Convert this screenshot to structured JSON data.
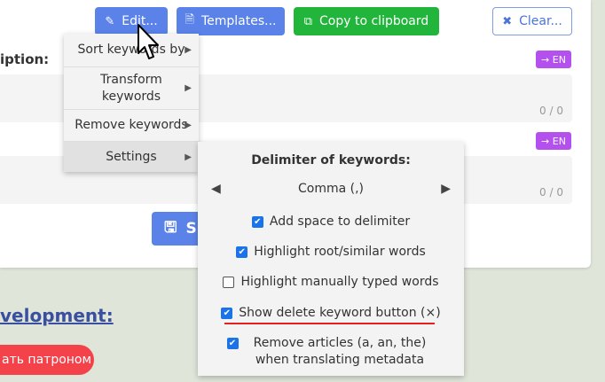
{
  "toolbar": {
    "edit_label": "Edit...",
    "templates_label": "Templates...",
    "copy_label": "Copy to clipboard",
    "clear_label": "Clear..."
  },
  "description_label": "iption:",
  "fields": [
    {
      "badge": "→ EN",
      "counter": "0 / 0"
    },
    {
      "badge": "→ EN",
      "counter": "0 / 0"
    }
  ],
  "save_label": "S",
  "development_heading": "velopment:",
  "patron_label": "ать патроном",
  "menu": {
    "items": [
      {
        "label": "Sort keywords by"
      },
      {
        "label": "Transform keywords"
      },
      {
        "label": "Remove keywords"
      },
      {
        "label": "Settings"
      }
    ]
  },
  "settings": {
    "title": "Delimiter of keywords:",
    "delimiter_value": "Comma (,)",
    "options": [
      {
        "label": "Add space to delimiter",
        "checked": true
      },
      {
        "label": "Highlight root/similar words",
        "checked": true
      },
      {
        "label": "Highlight manually typed words",
        "checked": false
      },
      {
        "label": "Show delete keyword button (×)",
        "checked": true
      },
      {
        "label": "Remove articles (a, an, the) when translating metadata",
        "checked": true
      }
    ]
  },
  "colors": {
    "primary": "#5a82e8",
    "success": "#22b53b",
    "badge": "#b451ee",
    "danger": "#f4424a",
    "highlight_underline": "#e62020"
  }
}
